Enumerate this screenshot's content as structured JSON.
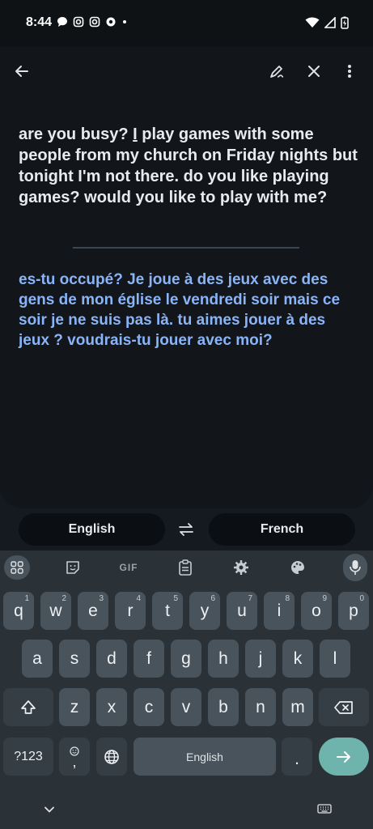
{
  "status_bar": {
    "time": "8:44"
  },
  "toolbar": {
    "back_icon": "arrow-left-icon",
    "handwriting_icon": "handwriting-icon",
    "clear_icon": "close-icon",
    "more_icon": "more-vert-icon"
  },
  "translation": {
    "source_before_cursor": "are you busy? ",
    "source_cursor_char": "I",
    "source_after_cursor": " play games with some people from my church on Friday nights but tonight I'm not there. do you like playing games? would you like to play with me?",
    "target": "es-tu occupé?  Je joue à des jeux avec des gens de mon église le vendredi soir mais ce soir je ne suis pas là.  tu aimes jouer à des jeux ?  voudrais-tu jouer avec moi?"
  },
  "languages": {
    "source": "English",
    "target": "French"
  },
  "keyboard": {
    "toolbar": {
      "gif_label": "GIF"
    },
    "row1": [
      {
        "k": "q",
        "h": "1"
      },
      {
        "k": "w",
        "h": "2"
      },
      {
        "k": "e",
        "h": "3"
      },
      {
        "k": "r",
        "h": "4"
      },
      {
        "k": "t",
        "h": "5"
      },
      {
        "k": "y",
        "h": "6"
      },
      {
        "k": "u",
        "h": "7"
      },
      {
        "k": "i",
        "h": "8"
      },
      {
        "k": "o",
        "h": "9"
      },
      {
        "k": "p",
        "h": "0"
      }
    ],
    "row2": [
      "a",
      "s",
      "d",
      "f",
      "g",
      "h",
      "j",
      "k",
      "l"
    ],
    "row3": [
      "z",
      "x",
      "c",
      "v",
      "b",
      "n",
      "m"
    ],
    "symbols_label": "?123",
    "emoji_comma_label": ",",
    "space_label": "English",
    "period_label": "."
  }
}
